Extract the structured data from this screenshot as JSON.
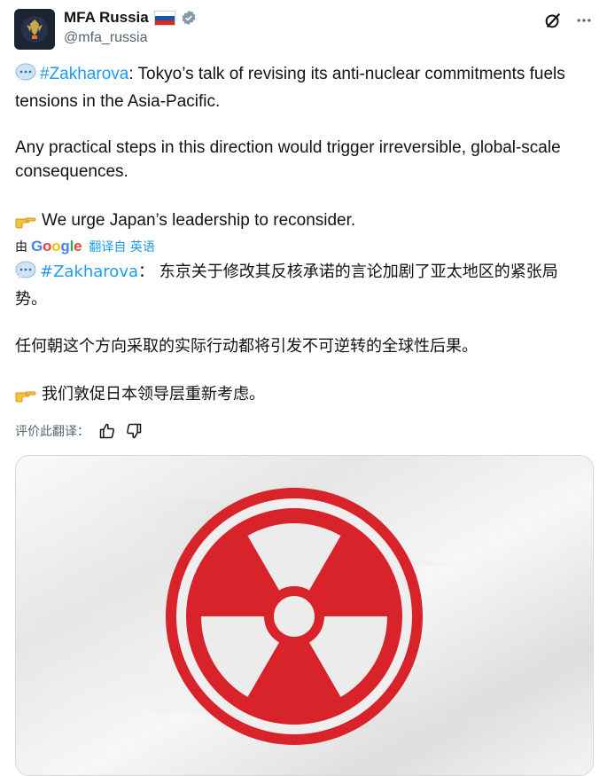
{
  "author": {
    "display_name": "MFA Russia",
    "handle": "@mfa_russia"
  },
  "icons": {
    "avatar": "emblem-icon",
    "flag": "russia-flag-icon",
    "verified": "verified-badge-icon",
    "grok": "grok-icon",
    "more": "more-options-icon",
    "speech": "speech-bubble-emoji",
    "point": "pointing-hand-emoji",
    "like": "thumbs-up-icon",
    "dislike": "thumbs-down-icon"
  },
  "original": {
    "hashtag": "#Zakharova",
    "line1_rest": ": Tokyo’s talk of revising its anti-nuclear commitments fuels tensions in the Asia-Pacific.",
    "para2": "Any practical steps in this direction would trigger irreversible, global-scale consequences.",
    "para3": "We urge Japan’s leadership to reconsider."
  },
  "translation_bar": {
    "by": "由",
    "google": "Google",
    "link": "翻译自 英语"
  },
  "translated": {
    "hashtag": "#Zakharova",
    "line1_rest": "： 东京关于修改其反核承诺的言论加剧了亚太地区的紧张局势。",
    "para2": "任何朝这个方向采取的实际行动都将引发不可逆转的全球性后果。",
    "para3": "我们敦促日本领导层重新考虑。"
  },
  "rate": {
    "label": "评价此翻译："
  },
  "colors": {
    "link": "#1d9bf0",
    "muted": "#536471",
    "hazard_red": "#d8232a"
  },
  "media": {
    "description_icon": "radiation-hazard-symbol"
  }
}
